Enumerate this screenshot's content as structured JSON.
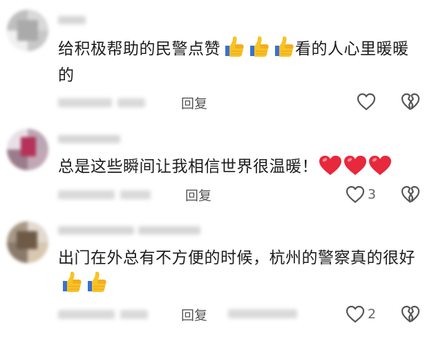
{
  "comments": [
    {
      "text": "给积极帮助的民警点赞",
      "text_after": "看的人心里暖暖的",
      "emoji_before_after": [
        "thumbs-up-emoji",
        "thumbs-up-emoji",
        "thumbs-up-emoji"
      ],
      "reply_label": "回复",
      "like_count": ""
    },
    {
      "text": "总是这些瞬间让我相信世界很温暖！",
      "emoji_trailing": [
        "red-heart-emoji",
        "red-heart-emoji",
        "red-heart-emoji"
      ],
      "reply_label": "回复",
      "like_count": "3"
    },
    {
      "text": "出门在外总有不方便的时候，杭州的警察真的很好",
      "emoji_trailing": [
        "thumbs-up-emoji",
        "thumbs-up-emoji"
      ],
      "reply_label": "回复",
      "like_count": "2"
    }
  ],
  "colors": {
    "thumb_yellow": "#F7C325",
    "thumb_orange": "#F29A1B",
    "heart_red": "#E8283C",
    "icon_gray": "#555555"
  }
}
